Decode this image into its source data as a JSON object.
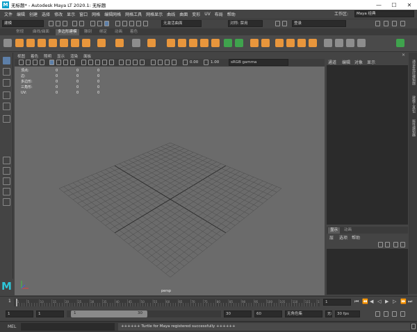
{
  "titlebar": {
    "logo": "M",
    "title": "无标题* - Autodesk Maya LT 2020.1: 无标题",
    "minimize": "—",
    "maximize": "☐",
    "close": "✕"
  },
  "menubar": {
    "items": [
      "文件",
      "编辑",
      "创建",
      "选择",
      "修改",
      "显示",
      "窗口",
      "网格",
      "编辑网格",
      "网格工具",
      "网格显示",
      "曲线",
      "曲面",
      "变形",
      "UV",
      "布局",
      "帮助"
    ],
    "workspace_label": "工作区:",
    "workspace_value": "Maya 经典"
  },
  "statusline": {
    "mode": "建模",
    "symmetry": "无激活曲面",
    "symmetry_label": "对称: 禁用",
    "login": "登录"
  },
  "shelf": {
    "tabs": [
      "常规",
      "曲线/曲面",
      "多边形建模",
      "雕刻",
      "绑定",
      "动画",
      "着色"
    ],
    "active_tab": 2
  },
  "viewport": {
    "menus": [
      "视图",
      "着色",
      "照明",
      "显示",
      "渲染",
      "面板"
    ],
    "exposure": "0.00",
    "gamma": "1.00",
    "colorspace": "sRGB gamma",
    "camera": "persp",
    "hud": {
      "rows": [
        {
          "label": "顶点:",
          "values": [
            "0",
            "0",
            "0"
          ]
        },
        {
          "label": "边:",
          "values": [
            "0",
            "0",
            "0"
          ]
        },
        {
          "label": "多边形:",
          "values": [
            "0",
            "0",
            "0"
          ]
        },
        {
          "label": "三角形:",
          "values": [
            "0",
            "0",
            "0"
          ]
        },
        {
          "label": "UV:",
          "values": [
            "0",
            "0",
            "0"
          ]
        }
      ]
    }
  },
  "channelbox": {
    "menus": [
      "通道",
      "编辑",
      "对象",
      "显示"
    ]
  },
  "right_tabs": [
    "通道盒/层编辑器",
    "建模工具包",
    "属性编辑器"
  ],
  "layer_editor": {
    "tabs": [
      "显示",
      "动画"
    ],
    "menus": [
      "层",
      "选项",
      "帮助"
    ]
  },
  "timeslider": {
    "ticks": [
      "1",
      "5",
      "10",
      "15",
      "20",
      "25",
      "30",
      "35",
      "40",
      "45",
      "50",
      "55",
      "60",
      "65",
      "70",
      "75",
      "80",
      "85",
      "90",
      "95",
      "100",
      "105",
      "110",
      "115",
      "120"
    ],
    "current_frame": "1"
  },
  "range": {
    "start": "1",
    "playback_start": "1",
    "range_label_start": "1",
    "range_label_end": "30",
    "playback_end": "30",
    "end": "60",
    "character_set": "无角色集",
    "anim_layer": "无动画层",
    "fps": "30 fps"
  },
  "commandline": {
    "label": "MEL",
    "output": "++++++ Turtle for Maya registered successfully ++++++"
  },
  "colors": {
    "accent_orange": "#e8963c",
    "viewport_bg": "#6b6b6b",
    "logo_cyan": "#2ec5d8"
  }
}
